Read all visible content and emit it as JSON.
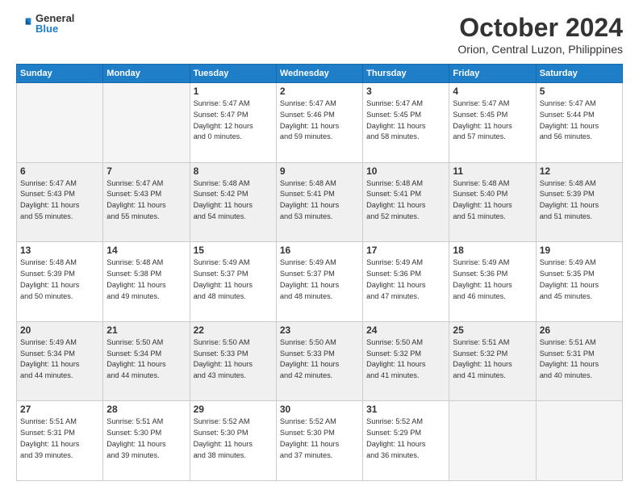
{
  "logo": {
    "general": "General",
    "blue": "Blue"
  },
  "title": "October 2024",
  "location": "Orion, Central Luzon, Philippines",
  "weekdays": [
    "Sunday",
    "Monday",
    "Tuesday",
    "Wednesday",
    "Thursday",
    "Friday",
    "Saturday"
  ],
  "weeks": [
    [
      {
        "day": "",
        "info": ""
      },
      {
        "day": "",
        "info": ""
      },
      {
        "day": "1",
        "info": "Sunrise: 5:47 AM\nSunset: 5:47 PM\nDaylight: 12 hours\nand 0 minutes."
      },
      {
        "day": "2",
        "info": "Sunrise: 5:47 AM\nSunset: 5:46 PM\nDaylight: 11 hours\nand 59 minutes."
      },
      {
        "day": "3",
        "info": "Sunrise: 5:47 AM\nSunset: 5:45 PM\nDaylight: 11 hours\nand 58 minutes."
      },
      {
        "day": "4",
        "info": "Sunrise: 5:47 AM\nSunset: 5:45 PM\nDaylight: 11 hours\nand 57 minutes."
      },
      {
        "day": "5",
        "info": "Sunrise: 5:47 AM\nSunset: 5:44 PM\nDaylight: 11 hours\nand 56 minutes."
      }
    ],
    [
      {
        "day": "6",
        "info": "Sunrise: 5:47 AM\nSunset: 5:43 PM\nDaylight: 11 hours\nand 55 minutes."
      },
      {
        "day": "7",
        "info": "Sunrise: 5:47 AM\nSunset: 5:43 PM\nDaylight: 11 hours\nand 55 minutes."
      },
      {
        "day": "8",
        "info": "Sunrise: 5:48 AM\nSunset: 5:42 PM\nDaylight: 11 hours\nand 54 minutes."
      },
      {
        "day": "9",
        "info": "Sunrise: 5:48 AM\nSunset: 5:41 PM\nDaylight: 11 hours\nand 53 minutes."
      },
      {
        "day": "10",
        "info": "Sunrise: 5:48 AM\nSunset: 5:41 PM\nDaylight: 11 hours\nand 52 minutes."
      },
      {
        "day": "11",
        "info": "Sunrise: 5:48 AM\nSunset: 5:40 PM\nDaylight: 11 hours\nand 51 minutes."
      },
      {
        "day": "12",
        "info": "Sunrise: 5:48 AM\nSunset: 5:39 PM\nDaylight: 11 hours\nand 51 minutes."
      }
    ],
    [
      {
        "day": "13",
        "info": "Sunrise: 5:48 AM\nSunset: 5:39 PM\nDaylight: 11 hours\nand 50 minutes."
      },
      {
        "day": "14",
        "info": "Sunrise: 5:48 AM\nSunset: 5:38 PM\nDaylight: 11 hours\nand 49 minutes."
      },
      {
        "day": "15",
        "info": "Sunrise: 5:49 AM\nSunset: 5:37 PM\nDaylight: 11 hours\nand 48 minutes."
      },
      {
        "day": "16",
        "info": "Sunrise: 5:49 AM\nSunset: 5:37 PM\nDaylight: 11 hours\nand 48 minutes."
      },
      {
        "day": "17",
        "info": "Sunrise: 5:49 AM\nSunset: 5:36 PM\nDaylight: 11 hours\nand 47 minutes."
      },
      {
        "day": "18",
        "info": "Sunrise: 5:49 AM\nSunset: 5:36 PM\nDaylight: 11 hours\nand 46 minutes."
      },
      {
        "day": "19",
        "info": "Sunrise: 5:49 AM\nSunset: 5:35 PM\nDaylight: 11 hours\nand 45 minutes."
      }
    ],
    [
      {
        "day": "20",
        "info": "Sunrise: 5:49 AM\nSunset: 5:34 PM\nDaylight: 11 hours\nand 44 minutes."
      },
      {
        "day": "21",
        "info": "Sunrise: 5:50 AM\nSunset: 5:34 PM\nDaylight: 11 hours\nand 44 minutes."
      },
      {
        "day": "22",
        "info": "Sunrise: 5:50 AM\nSunset: 5:33 PM\nDaylight: 11 hours\nand 43 minutes."
      },
      {
        "day": "23",
        "info": "Sunrise: 5:50 AM\nSunset: 5:33 PM\nDaylight: 11 hours\nand 42 minutes."
      },
      {
        "day": "24",
        "info": "Sunrise: 5:50 AM\nSunset: 5:32 PM\nDaylight: 11 hours\nand 41 minutes."
      },
      {
        "day": "25",
        "info": "Sunrise: 5:51 AM\nSunset: 5:32 PM\nDaylight: 11 hours\nand 41 minutes."
      },
      {
        "day": "26",
        "info": "Sunrise: 5:51 AM\nSunset: 5:31 PM\nDaylight: 11 hours\nand 40 minutes."
      }
    ],
    [
      {
        "day": "27",
        "info": "Sunrise: 5:51 AM\nSunset: 5:31 PM\nDaylight: 11 hours\nand 39 minutes."
      },
      {
        "day": "28",
        "info": "Sunrise: 5:51 AM\nSunset: 5:30 PM\nDaylight: 11 hours\nand 39 minutes."
      },
      {
        "day": "29",
        "info": "Sunrise: 5:52 AM\nSunset: 5:30 PM\nDaylight: 11 hours\nand 38 minutes."
      },
      {
        "day": "30",
        "info": "Sunrise: 5:52 AM\nSunset: 5:30 PM\nDaylight: 11 hours\nand 37 minutes."
      },
      {
        "day": "31",
        "info": "Sunrise: 5:52 AM\nSunset: 5:29 PM\nDaylight: 11 hours\nand 36 minutes."
      },
      {
        "day": "",
        "info": ""
      },
      {
        "day": "",
        "info": ""
      }
    ]
  ]
}
